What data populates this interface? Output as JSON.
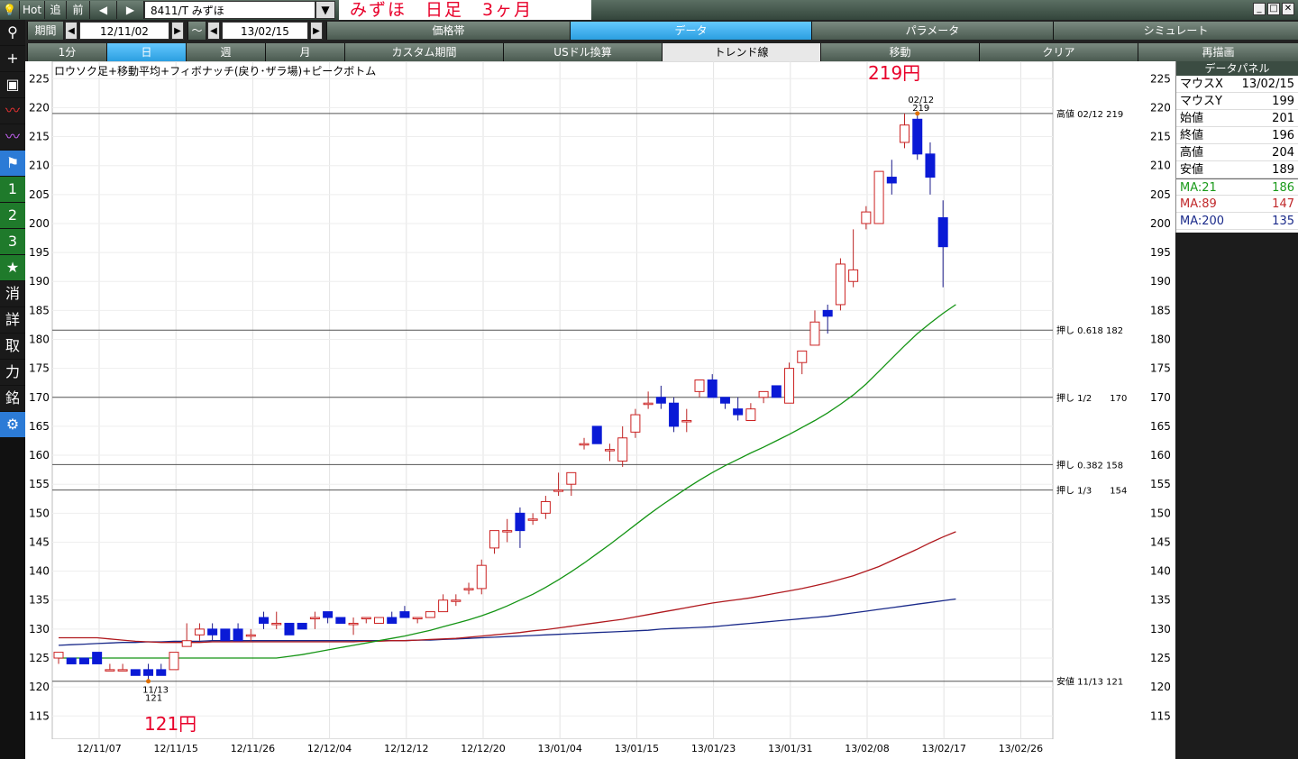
{
  "topbar": {
    "hot": "Hot",
    "forward": "追",
    "back": "前",
    "symbol": "8411/T みずほ",
    "title": "みずほ　日足　3ヶ月"
  },
  "period": {
    "label": "期間",
    "from": "12/11/02",
    "tilde": "～",
    "to": "13/02/15"
  },
  "menu": [
    "価格帯",
    "データ",
    "パラメータ",
    "シミュレート"
  ],
  "ranges": [
    "1分",
    "日",
    "週",
    "月",
    "カスタム期間",
    "USドル換算",
    "トレンド線",
    "移動",
    "クリア",
    "再描画"
  ],
  "sidebar": [
    "+",
    "▣",
    "1",
    "2",
    "3",
    "★",
    "消",
    "詳",
    "取",
    "力",
    "銘",
    "⚙"
  ],
  "caption": "ロウソク足+移動平均+フィボナッチ(戻り･ザラ場)+ピークボトム",
  "annotations": {
    "high_price": "219円",
    "low_price": "121円",
    "high_date": "02/12",
    "high_value": "219",
    "low_date": "11/13",
    "low_value": "121"
  },
  "levels": [
    {
      "label": "高値 02/12 219",
      "value": 219
    },
    {
      "label": "押し 0.618 182",
      "value": 181.6
    },
    {
      "label": "押し 1/2　　170",
      "value": 170
    },
    {
      "label": "押し 0.382 158",
      "value": 158.4
    },
    {
      "label": "押し 1/3　　154",
      "value": 154
    },
    {
      "label": "安値 11/13 121",
      "value": 121
    }
  ],
  "data_panel": {
    "title": "データパネル",
    "rows": [
      {
        "k": "マウスX",
        "v": "13/02/15",
        "c": "#000"
      },
      {
        "k": "マウスY",
        "v": "199",
        "c": "#000"
      },
      {
        "k": "始値",
        "v": "201",
        "c": "#000"
      },
      {
        "k": "終値",
        "v": "196",
        "c": "#000"
      },
      {
        "k": "高値",
        "v": "204",
        "c": "#000"
      },
      {
        "k": "安値",
        "v": "189",
        "c": "#000"
      },
      {
        "k": "MA:21",
        "v": "186",
        "c": "#1a9a1a"
      },
      {
        "k": "MA:89",
        "v": "147",
        "c": "#c0282a"
      },
      {
        "k": "MA:200",
        "v": "135",
        "c": "#1a2a8a"
      }
    ]
  },
  "chart_data": {
    "type": "candlestick",
    "ylim": [
      111,
      228
    ],
    "yticks": [
      115,
      120,
      125,
      130,
      135,
      140,
      145,
      150,
      155,
      160,
      165,
      170,
      175,
      180,
      185,
      190,
      195,
      200,
      205,
      210,
      215,
      220,
      225
    ],
    "xtick_labels": [
      "12/11/07",
      "12/11/15",
      "12/11/26",
      "12/12/04",
      "12/12/12",
      "12/12/20",
      "13/01/04",
      "13/01/15",
      "13/01/23",
      "13/01/31",
      "13/02/08",
      "13/02/17",
      "13/02/26"
    ],
    "candles": [
      {
        "d": "12/11/02",
        "o": 125,
        "h": 126,
        "l": 124,
        "c": 126
      },
      {
        "d": "12/11/05",
        "o": 125,
        "h": 125,
        "l": 124,
        "c": 124
      },
      {
        "d": "12/11/06",
        "o": 125,
        "h": 125,
        "l": 124,
        "c": 124
      },
      {
        "d": "12/11/07",
        "o": 126,
        "h": 126,
        "l": 124,
        "c": 124
      },
      {
        "d": "12/11/08",
        "o": 123,
        "h": 124,
        "l": 123,
        "c": 123
      },
      {
        "d": "12/11/09",
        "o": 123,
        "h": 124,
        "l": 123,
        "c": 123
      },
      {
        "d": "12/11/12",
        "o": 123,
        "h": 123,
        "l": 122,
        "c": 122
      },
      {
        "d": "12/11/13",
        "o": 123,
        "h": 124,
        "l": 121,
        "c": 122
      },
      {
        "d": "12/11/14",
        "o": 123,
        "h": 124,
        "l": 122,
        "c": 122
      },
      {
        "d": "12/11/15",
        "o": 123,
        "h": 126,
        "l": 123,
        "c": 126
      },
      {
        "d": "12/11/16",
        "o": 127,
        "h": 131,
        "l": 127,
        "c": 128
      },
      {
        "d": "12/11/19",
        "o": 129,
        "h": 131,
        "l": 128,
        "c": 130
      },
      {
        "d": "12/11/20",
        "o": 130,
        "h": 131,
        "l": 128,
        "c": 129
      },
      {
        "d": "12/11/21",
        "o": 130,
        "h": 130,
        "l": 128,
        "c": 128
      },
      {
        "d": "12/11/22",
        "o": 130,
        "h": 131,
        "l": 128,
        "c": 128
      },
      {
        "d": "12/11/26",
        "o": 129,
        "h": 130,
        "l": 128,
        "c": 129
      },
      {
        "d": "12/11/27",
        "o": 132,
        "h": 133,
        "l": 130,
        "c": 131
      },
      {
        "d": "12/11/28",
        "o": 131,
        "h": 133,
        "l": 130,
        "c": 131
      },
      {
        "d": "12/11/29",
        "o": 131,
        "h": 131,
        "l": 129,
        "c": 129
      },
      {
        "d": "12/11/30",
        "o": 131,
        "h": 131,
        "l": 130,
        "c": 130
      },
      {
        "d": "12/12/03",
        "o": 132,
        "h": 133,
        "l": 130,
        "c": 132
      },
      {
        "d": "12/12/04",
        "o": 133,
        "h": 133,
        "l": 131,
        "c": 132
      },
      {
        "d": "12/12/05",
        "o": 132,
        "h": 132,
        "l": 131,
        "c": 131
      },
      {
        "d": "12/12/06",
        "o": 131,
        "h": 132,
        "l": 129,
        "c": 131
      },
      {
        "d": "12/12/07",
        "o": 132,
        "h": 132,
        "l": 131,
        "c": 132
      },
      {
        "d": "12/12/10",
        "o": 131,
        "h": 132,
        "l": 131,
        "c": 132
      },
      {
        "d": "12/12/11",
        "o": 132,
        "h": 133,
        "l": 131,
        "c": 131
      },
      {
        "d": "12/12/12",
        "o": 133,
        "h": 134,
        "l": 132,
        "c": 132
      },
      {
        "d": "12/12/13",
        "o": 132,
        "h": 132,
        "l": 131,
        "c": 132
      },
      {
        "d": "12/12/14",
        "o": 132,
        "h": 133,
        "l": 132,
        "c": 133
      },
      {
        "d": "12/12/17",
        "o": 133,
        "h": 136,
        "l": 133,
        "c": 135
      },
      {
        "d": "12/12/18",
        "o": 135,
        "h": 136,
        "l": 134,
        "c": 135
      },
      {
        "d": "12/12/19",
        "o": 137,
        "h": 138,
        "l": 136,
        "c": 137
      },
      {
        "d": "12/12/20",
        "o": 137,
        "h": 142,
        "l": 136,
        "c": 141
      },
      {
        "d": "12/12/21",
        "o": 144,
        "h": 147,
        "l": 143,
        "c": 147
      },
      {
        "d": "12/12/25",
        "o": 147,
        "h": 149,
        "l": 145,
        "c": 147
      },
      {
        "d": "12/12/26",
        "o": 150,
        "h": 151,
        "l": 144,
        "c": 147
      },
      {
        "d": "12/12/27",
        "o": 149,
        "h": 150,
        "l": 148,
        "c": 149
      },
      {
        "d": "12/12/28",
        "o": 150,
        "h": 153,
        "l": 149,
        "c": 152
      },
      {
        "d": "13/01/04",
        "o": 154,
        "h": 157,
        "l": 153,
        "c": 154
      },
      {
        "d": "13/01/07",
        "o": 155,
        "h": 157,
        "l": 153,
        "c": 157
      },
      {
        "d": "13/01/08",
        "o": 162,
        "h": 163,
        "l": 161,
        "c": 162
      },
      {
        "d": "13/01/09",
        "o": 165,
        "h": 165,
        "l": 162,
        "c": 162
      },
      {
        "d": "13/01/10",
        "o": 161,
        "h": 162,
        "l": 159,
        "c": 161
      },
      {
        "d": "13/01/11",
        "o": 159,
        "h": 165,
        "l": 158,
        "c": 163
      },
      {
        "d": "13/01/15",
        "o": 164,
        "h": 168,
        "l": 163,
        "c": 167
      },
      {
        "d": "13/01/16",
        "o": 169,
        "h": 171,
        "l": 168,
        "c": 169
      },
      {
        "d": "13/01/17",
        "o": 170,
        "h": 172,
        "l": 168,
        "c": 169
      },
      {
        "d": "13/01/18",
        "o": 169,
        "h": 170,
        "l": 164,
        "c": 165
      },
      {
        "d": "13/01/21",
        "o": 166,
        "h": 168,
        "l": 164,
        "c": 166
      },
      {
        "d": "13/01/22",
        "o": 171,
        "h": 173,
        "l": 170,
        "c": 173
      },
      {
        "d": "13/01/23",
        "o": 173,
        "h": 174,
        "l": 170,
        "c": 170
      },
      {
        "d": "13/01/24",
        "o": 170,
        "h": 170,
        "l": 168,
        "c": 169
      },
      {
        "d": "13/01/25",
        "o": 168,
        "h": 170,
        "l": 166,
        "c": 167
      },
      {
        "d": "13/01/28",
        "o": 166,
        "h": 169,
        "l": 166,
        "c": 168
      },
      {
        "d": "13/01/29",
        "o": 170,
        "h": 171,
        "l": 169,
        "c": 171
      },
      {
        "d": "13/01/30",
        "o": 172,
        "h": 172,
        "l": 170,
        "c": 170
      },
      {
        "d": "13/01/31",
        "o": 169,
        "h": 176,
        "l": 169,
        "c": 175
      },
      {
        "d": "13/02/01",
        "o": 176,
        "h": 178,
        "l": 174,
        "c": 178
      },
      {
        "d": "13/02/04",
        "o": 179,
        "h": 185,
        "l": 179,
        "c": 183
      },
      {
        "d": "13/02/05",
        "o": 185,
        "h": 186,
        "l": 181,
        "c": 184
      },
      {
        "d": "13/02/06",
        "o": 186,
        "h": 194,
        "l": 185,
        "c": 193
      },
      {
        "d": "13/02/07",
        "o": 190,
        "h": 199,
        "l": 189,
        "c": 192
      },
      {
        "d": "13/02/08",
        "o": 200,
        "h": 203,
        "l": 199,
        "c": 202
      },
      {
        "d": "13/02/12",
        "o": 200,
        "h": 209,
        "l": 200,
        "c": 209
      },
      {
        "d": "13/02/13",
        "o": 208,
        "h": 211,
        "l": 205,
        "c": 207
      },
      {
        "d": "13/02/14",
        "o": 214,
        "h": 219,
        "l": 213,
        "c": 217
      },
      {
        "d": "13/02/15",
        "o": 218,
        "h": 219,
        "l": 211,
        "c": 212
      },
      {
        "d": "13/02/18",
        "o": 212,
        "h": 214,
        "l": 205,
        "c": 208
      },
      {
        "d": "13/02/19",
        "o": 201,
        "h": 204,
        "l": 189,
        "c": 196
      }
    ],
    "ma21": [
      125,
      125,
      125,
      125,
      125,
      125,
      125,
      125,
      125,
      125,
      125,
      125,
      125,
      125,
      125,
      125,
      125,
      125,
      125.3,
      125.6,
      126,
      126.4,
      126.8,
      127.2,
      127.6,
      128,
      128.4,
      128.8,
      129.3,
      129.8,
      130.4,
      131,
      131.6,
      132.3,
      133.1,
      134,
      135,
      136,
      137.2,
      138.5,
      139.9,
      141.4,
      143,
      144.6,
      146.3,
      148,
      149.7,
      151.3,
      152.8,
      154.3,
      155.7,
      157,
      158.2,
      159.3,
      160.4,
      161.4,
      162.5,
      163.6,
      164.8,
      166,
      167.3,
      168.8,
      170.4,
      172.3,
      174.5,
      176.7,
      178.9,
      181,
      182.8,
      184.5,
      186
    ],
    "ma89": [
      128.5,
      128.5,
      128.5,
      128.5,
      128.3,
      128.1,
      127.9,
      127.8,
      127.7,
      127.7,
      127.7,
      127.7,
      127.8,
      127.8,
      127.8,
      127.8,
      127.8,
      127.8,
      127.8,
      127.8,
      127.8,
      127.8,
      127.8,
      127.8,
      127.9,
      127.9,
      128,
      128,
      128.1,
      128.2,
      128.3,
      128.4,
      128.6,
      128.8,
      129,
      129.2,
      129.4,
      129.7,
      129.9,
      130.2,
      130.5,
      130.8,
      131.1,
      131.4,
      131.7,
      132.1,
      132.5,
      132.9,
      133.3,
      133.7,
      134.1,
      134.5,
      134.8,
      135.1,
      135.4,
      135.8,
      136.2,
      136.6,
      137,
      137.5,
      138,
      138.6,
      139.2,
      140,
      140.8,
      141.8,
      142.8,
      143.8,
      144.9,
      145.9,
      146.8
    ],
    "ma200": [
      127.2,
      127.3,
      127.4,
      127.5,
      127.6,
      127.7,
      127.7,
      127.8,
      127.8,
      127.9,
      127.9,
      127.9,
      128,
      128,
      128,
      128,
      128,
      128,
      128,
      128,
      128,
      128,
      128,
      128,
      128,
      128,
      128,
      128,
      128.1,
      128.1,
      128.2,
      128.3,
      128.4,
      128.5,
      128.6,
      128.7,
      128.8,
      128.9,
      129,
      129.1,
      129.2,
      129.3,
      129.4,
      129.5,
      129.6,
      129.7,
      129.8,
      130,
      130.1,
      130.2,
      130.3,
      130.4,
      130.6,
      130.8,
      131,
      131.2,
      131.4,
      131.6,
      131.8,
      132,
      132.2,
      132.5,
      132.8,
      133.1,
      133.4,
      133.7,
      134,
      134.3,
      134.6,
      134.9,
      135.2
    ],
    "peak": {
      "index": 67,
      "value": 219
    },
    "bottom": {
      "index": 7,
      "value": 121
    }
  }
}
